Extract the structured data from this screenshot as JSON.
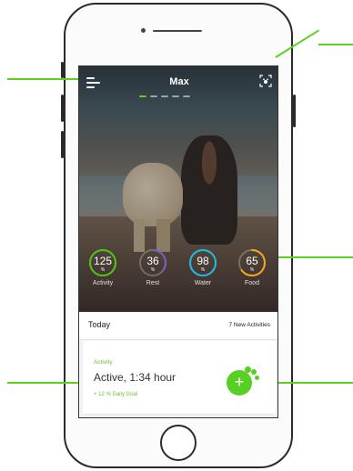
{
  "app": {
    "pet_name": "Max",
    "carousel": {
      "count": 5,
      "active_index": 0
    },
    "colors": {
      "accent": "#57d121",
      "activity": "#4fc414",
      "rest": "#7a5cc8",
      "water": "#22b8e6",
      "food": "#f5a623"
    }
  },
  "header": {
    "menu_icon": "hamburger-menu-icon",
    "scan_icon": "scan-camera-icon"
  },
  "stats": [
    {
      "value": "125",
      "unit": "%",
      "label": "Activity",
      "progress": 1.0
    },
    {
      "value": "36",
      "unit": "%",
      "label": "Rest",
      "progress": 0.36
    },
    {
      "value": "98",
      "unit": "%",
      "label": "Water",
      "progress": 0.98
    },
    {
      "value": "65",
      "unit": "%",
      "label": "Food",
      "progress": 0.65
    }
  ],
  "today": {
    "title": "Today",
    "new_activities": "7 New Activities"
  },
  "card": {
    "category": "Activity",
    "summary": "Active, 1:34 hour",
    "goal": "+ 12 % Daily Goal",
    "add_label": "+",
    "add_icon": "add-paw-icon"
  }
}
